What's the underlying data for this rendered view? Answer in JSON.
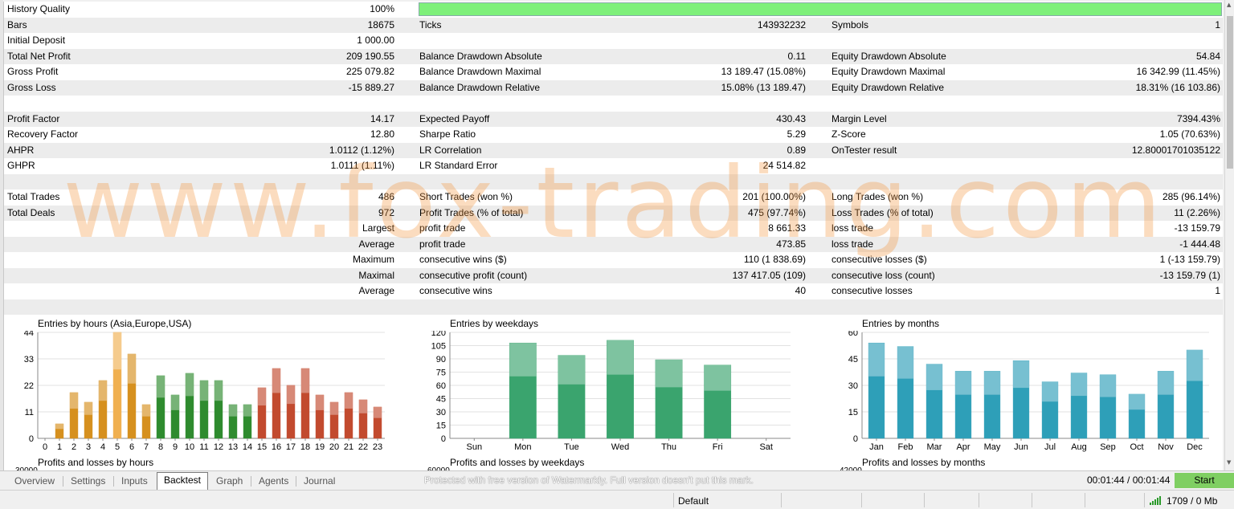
{
  "watermark": "www.fox-trading.com",
  "history_quality": {
    "label": "History Quality",
    "value": "100%",
    "fill": 1.0
  },
  "rows": [
    [
      {
        "label": "Bars",
        "value": "18675"
      },
      {
        "label": "Ticks",
        "value": "143932232"
      },
      {
        "label": "Symbols",
        "value": "1"
      }
    ],
    [
      {
        "label": "Initial Deposit",
        "value": "1 000.00"
      },
      {
        "label": "",
        "value": ""
      },
      {
        "label": "",
        "value": ""
      }
    ],
    [
      {
        "label": "Total Net Profit",
        "value": "209 190.55"
      },
      {
        "label": "Balance Drawdown Absolute",
        "value": "0.11"
      },
      {
        "label": "Equity Drawdown Absolute",
        "value": "54.84"
      }
    ],
    [
      {
        "label": "Gross Profit",
        "value": "225 079.82"
      },
      {
        "label": "Balance Drawdown Maximal",
        "value": "13 189.47 (15.08%)"
      },
      {
        "label": "Equity Drawdown Maximal",
        "value": "16 342.99 (11.45%)"
      }
    ],
    [
      {
        "label": "Gross Loss",
        "value": "-15 889.27"
      },
      {
        "label": "Balance Drawdown Relative",
        "value": "15.08% (13 189.47)"
      },
      {
        "label": "Equity Drawdown Relative",
        "value": "18.31% (16 103.86)"
      }
    ],
    [
      {
        "label": "",
        "value": ""
      },
      {
        "label": "",
        "value": ""
      },
      {
        "label": "",
        "value": ""
      }
    ],
    [
      {
        "label": "Profit Factor",
        "value": "14.17"
      },
      {
        "label": "Expected Payoff",
        "value": "430.43"
      },
      {
        "label": "Margin Level",
        "value": "7394.43%"
      }
    ],
    [
      {
        "label": "Recovery Factor",
        "value": "12.80"
      },
      {
        "label": "Sharpe Ratio",
        "value": "5.29"
      },
      {
        "label": "Z-Score",
        "value": "1.05 (70.63%)"
      }
    ],
    [
      {
        "label": "AHPR",
        "value": "1.0112 (1.12%)"
      },
      {
        "label": "LR Correlation",
        "value": "0.89"
      },
      {
        "label": "OnTester result",
        "value": "12.80001701035122"
      }
    ],
    [
      {
        "label": "GHPR",
        "value": "1.0111 (1.11%)"
      },
      {
        "label": "LR Standard Error",
        "value": "24 514.82"
      },
      {
        "label": "",
        "value": ""
      }
    ],
    [
      {
        "label": "",
        "value": ""
      },
      {
        "label": "",
        "value": ""
      },
      {
        "label": "",
        "value": ""
      }
    ],
    [
      {
        "label": "Total Trades",
        "value": "486"
      },
      {
        "label": "Short Trades (won %)",
        "value": "201 (100.00%)"
      },
      {
        "label": "Long Trades (won %)",
        "value": "285 (96.14%)"
      }
    ],
    [
      {
        "label": "Total Deals",
        "value": "972"
      },
      {
        "label": "Profit Trades (% of total)",
        "value": "475 (97.74%)"
      },
      {
        "label": "Loss Trades (% of total)",
        "value": "11 (2.26%)"
      }
    ],
    [
      {
        "label": "",
        "value": "Largest"
      },
      {
        "label": "profit trade",
        "value": "8 661.33"
      },
      {
        "label": "loss trade",
        "value": "-13 159.79"
      }
    ],
    [
      {
        "label": "",
        "value": "Average"
      },
      {
        "label": "profit trade",
        "value": "473.85"
      },
      {
        "label": "loss trade",
        "value": "-1 444.48"
      }
    ],
    [
      {
        "label": "",
        "value": "Maximum"
      },
      {
        "label": "consecutive wins ($)",
        "value": "110 (1 838.69)"
      },
      {
        "label": "consecutive losses ($)",
        "value": "1 (-13 159.79)"
      }
    ],
    [
      {
        "label": "",
        "value": "Maximal"
      },
      {
        "label": "consecutive profit (count)",
        "value": "137 417.05 (109)"
      },
      {
        "label": "consecutive loss (count)",
        "value": "-13 159.79 (1)"
      }
    ],
    [
      {
        "label": "",
        "value": "Average"
      },
      {
        "label": "consecutive wins",
        "value": "40"
      },
      {
        "label": "consecutive losses",
        "value": "1"
      }
    ],
    [
      {
        "label": "",
        "value": ""
      },
      {
        "label": "",
        "value": ""
      },
      {
        "label": "",
        "value": ""
      }
    ]
  ],
  "chart_data": [
    {
      "type": "bar",
      "title": "Entries by hours (Asia,Europe,USA)",
      "categories": [
        "0",
        "1",
        "2",
        "3",
        "4",
        "5",
        "6",
        "7",
        "8",
        "9",
        "10",
        "11",
        "12",
        "13",
        "14",
        "15",
        "16",
        "17",
        "18",
        "19",
        "20",
        "21",
        "22",
        "23"
      ],
      "values": [
        0,
        6,
        19,
        15,
        24,
        44,
        35,
        14,
        26,
        18,
        27,
        24,
        24,
        14,
        14,
        21,
        29,
        22,
        29,
        18,
        15,
        19,
        16,
        13
      ],
      "yticks": [
        "0",
        "11",
        "22",
        "33",
        "44"
      ],
      "ylim": [
        0,
        44
      ],
      "colors": [
        "#d6901e",
        "#d6901e",
        "#d6901e",
        "#d6901e",
        "#d6901e",
        "#f0b050",
        "#d6901e",
        "#d6901e",
        "#2e8b2e",
        "#2e8b2e",
        "#2e8b2e",
        "#2e8b2e",
        "#2e8b2e",
        "#2e8b2e",
        "#2e8b2e",
        "#c24a2e",
        "#c24a2e",
        "#c24a2e",
        "#c24a2e",
        "#c24a2e",
        "#c24a2e",
        "#c24a2e",
        "#c24a2e",
        "#c24a2e"
      ]
    },
    {
      "type": "bar",
      "title": "Entries by weekdays",
      "categories": [
        "Sun",
        "Mon",
        "Tue",
        "Wed",
        "Thu",
        "Fri",
        "Sat"
      ],
      "values": [
        0,
        108,
        94,
        111,
        89,
        83,
        0
      ],
      "yticks": [
        "0",
        "15",
        "30",
        "45",
        "60",
        "75",
        "90",
        "105",
        "120"
      ],
      "ylim": [
        0,
        120
      ],
      "color": "#3aa46e"
    },
    {
      "type": "bar",
      "title": "Entries by months",
      "categories": [
        "Jan",
        "Feb",
        "Mar",
        "Apr",
        "May",
        "Jun",
        "Jul",
        "Aug",
        "Sep",
        "Oct",
        "Nov",
        "Dec"
      ],
      "values": [
        54,
        52,
        42,
        38,
        38,
        44,
        32,
        37,
        36,
        25,
        38,
        50
      ],
      "yticks": [
        "0",
        "15",
        "30",
        "45",
        "60"
      ],
      "ylim": [
        0,
        60
      ],
      "color": "#2e9fb8"
    }
  ],
  "partial_charts": [
    {
      "title": "Profits and losses by hours",
      "ylabel_top": "30000"
    },
    {
      "title": "Profits and losses by weekdays",
      "ylabel_top": "60000"
    },
    {
      "title": "Profits and losses by months",
      "ylabel_top": "42000"
    }
  ],
  "tabs": [
    "Overview",
    "Settings",
    "Inputs",
    "Backtest",
    "Graph",
    "Agents",
    "Journal"
  ],
  "active_tab": "Backtest",
  "protected_notice": "Protected with free version of Watermarkly. Full version doesn't put this mark.",
  "timer": "00:01:44 / 00:01:44",
  "start_label": "Start",
  "status": {
    "profile": "Default",
    "memory": "1709 / 0 Mb"
  },
  "colors": {
    "accent_green": "#7fcf62",
    "quality_fill": "#7ef07a"
  }
}
